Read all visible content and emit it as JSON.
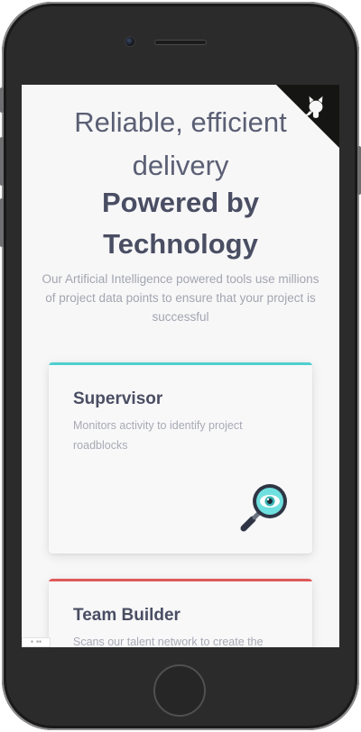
{
  "hero": {
    "line1a": "Reliable, efficient",
    "line1b": "delivery",
    "line2a": "Powered by",
    "line2b": "Technology",
    "subtitle": "Our Artificial Intelligence powered tools use millions of project data points to ensure that your project is successful"
  },
  "corner": {
    "icon": "github-octocat-icon",
    "color": "#151513"
  },
  "cards": [
    {
      "title": "Supervisor",
      "description": "Monitors activity to identify project roadblocks",
      "icon": "magnifying-eye-icon",
      "accent": "#4fcfcf"
    },
    {
      "title": "Team Builder",
      "description": "Scans our talent network to create the",
      "accent": "#e05a5a"
    }
  ],
  "colors": {
    "heading": "#4a4e63",
    "body_text": "#a3a5b0",
    "screen_bg": "#f7f7f8",
    "device_frame": "#2b2b2c"
  }
}
